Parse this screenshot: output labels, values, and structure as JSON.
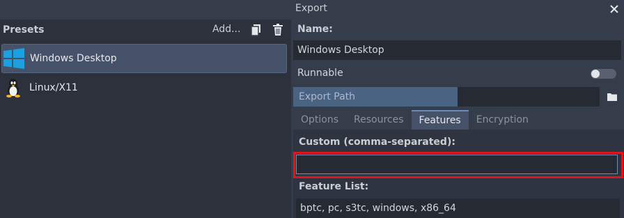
{
  "window": {
    "title": "Export"
  },
  "presets": {
    "label": "Presets",
    "add_label": "Add...",
    "items": [
      {
        "label": "Windows Desktop",
        "selected": true,
        "icon": "windows-icon"
      },
      {
        "label": "Linux/X11",
        "selected": false,
        "icon": "linux-tux-icon"
      }
    ]
  },
  "details": {
    "name_label": "Name:",
    "name_value": "Windows Desktop",
    "runnable_label": "Runnable",
    "runnable_on": false,
    "export_path_placeholder": "Export Path",
    "tabs": [
      "Options",
      "Resources",
      "Features",
      "Encryption"
    ],
    "active_tab": "Features",
    "custom_label": "Custom (comma-separated):",
    "custom_value": "",
    "feature_list_label": "Feature List:",
    "feature_list_value": "bptc, pc, s3tc, windows, x86_64"
  },
  "colors": {
    "background": "#363d4a",
    "panel": "#2c313b",
    "selected": "#45526a",
    "accent": "#6d8bb9",
    "highlight": "#e0141c"
  }
}
